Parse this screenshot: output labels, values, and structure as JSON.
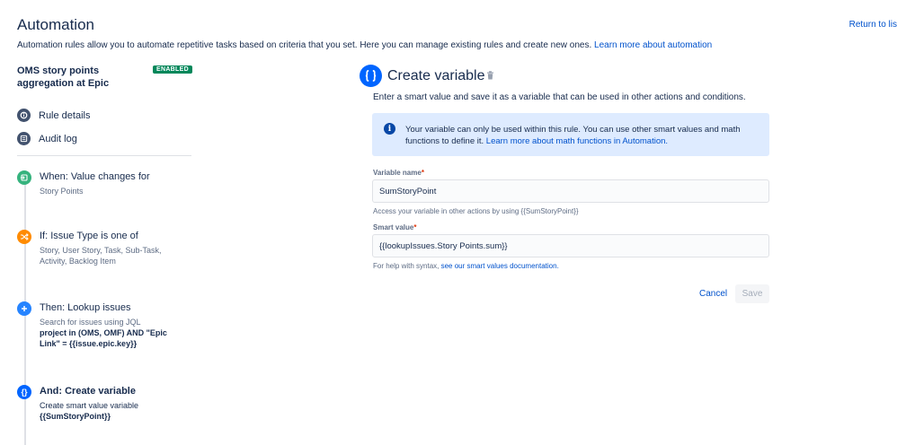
{
  "header": {
    "title": "Automation",
    "return_link": "Return to lis",
    "description": "Automation rules allow you to automate repetitive tasks based on criteria that you set. Here you can manage existing rules and create new ones.",
    "learn_more": "Learn more about automation"
  },
  "sidebar": {
    "rule_name": "OMS story points aggregation at Epic",
    "status_badge": "ENABLED",
    "links": [
      {
        "label": "Rule details",
        "icon": "info-icon"
      },
      {
        "label": "Audit log",
        "icon": "list-icon"
      }
    ],
    "steps": [
      {
        "title": "When: Value changes for",
        "subtitle": "Story Points",
        "color": "#36b37e",
        "icon": "trigger-icon"
      },
      {
        "title": "If: Issue Type is one of",
        "subtitle": "Story, User Story, Task, Sub-Task, Activity, Backlog Item",
        "color": "#ff8b00",
        "icon": "condition-icon"
      },
      {
        "title": "Then: Lookup issues",
        "subtitle": "Search for issues using JQL",
        "bold": "project in (OMS, OMF) AND \"Epic Link\" = {{issue.epic.key}}",
        "color": "#2684ff",
        "icon": "plus-icon"
      },
      {
        "title": "And: Create variable",
        "subtitle": "Create smart value variable",
        "bold": "{{SumStoryPoint}}",
        "color": "#0065ff",
        "icon": "variable-icon"
      }
    ]
  },
  "panel": {
    "title": "Create variable",
    "description": "Enter a smart value and save it as a variable that can be used in other actions and conditions.",
    "info_text": "Your variable can only be used within this rule. You can use other smart values and math functions to define it.",
    "info_link": "Learn more about math functions in Automation.",
    "variable_name": {
      "label": "Variable name",
      "required_mark": "*",
      "value": "SumStoryPoint",
      "help": "Access your variable in other actions by using {{SumStoryPoint}}"
    },
    "smart_value": {
      "label": "Smart value",
      "required_mark": "*",
      "value": "{{lookupIssues.Story Points.sum}}",
      "help_prefix": "For help with syntax,",
      "help_link": "see our smart values documentation."
    },
    "cancel_label": "Cancel",
    "save_label": "Save"
  },
  "colors": {
    "accent": "#0052cc",
    "enabled_badge": "#00875a",
    "info_bg": "#deebff"
  }
}
